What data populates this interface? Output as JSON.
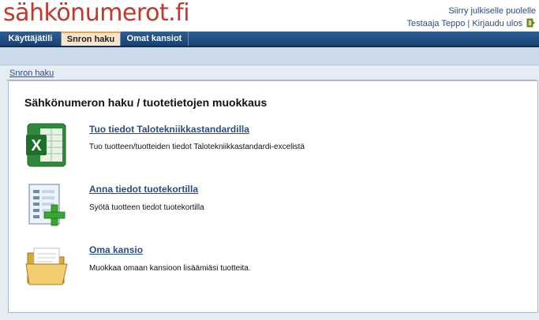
{
  "header": {
    "logo_text": "sähkönumerot.fi",
    "public_link": "Siirry julkiselle puolelle",
    "user_name": "Testaaja Teppo",
    "separator": "|",
    "logout": "Kirjaudu ulos"
  },
  "nav": {
    "tabs": [
      {
        "label": "Käyttäjätili",
        "active": false
      },
      {
        "label": "Snron haku",
        "active": true
      },
      {
        "label": "Omat kansiot",
        "active": false
      }
    ]
  },
  "breadcrumb": "Snron haku",
  "main": {
    "title": "Sähkönumeron haku / tuotetietojen muokkaus",
    "items": [
      {
        "icon": "excel-icon",
        "link": "Tuo tiedot Talotekniikkastandardilla",
        "desc": "Tuo tuotteen/tuotteiden tiedot Talotekniikkastandardi-excelistä"
      },
      {
        "icon": "product-card-add-icon",
        "link": "Anna tiedot tuotekortilla",
        "desc": "Syötä tuotteen tiedot tuotekortilla"
      },
      {
        "icon": "folder-icon",
        "link": "Oma kansio",
        "desc": "Muokkaa omaan kansioon lisäämiäsi tuotteita."
      }
    ]
  },
  "colors": {
    "logo": "#c0392b",
    "nav": "#1f4c80",
    "active_tab": "#fbe3cc",
    "link": "#2b4c85",
    "content_bg": "#e6ecf3"
  }
}
